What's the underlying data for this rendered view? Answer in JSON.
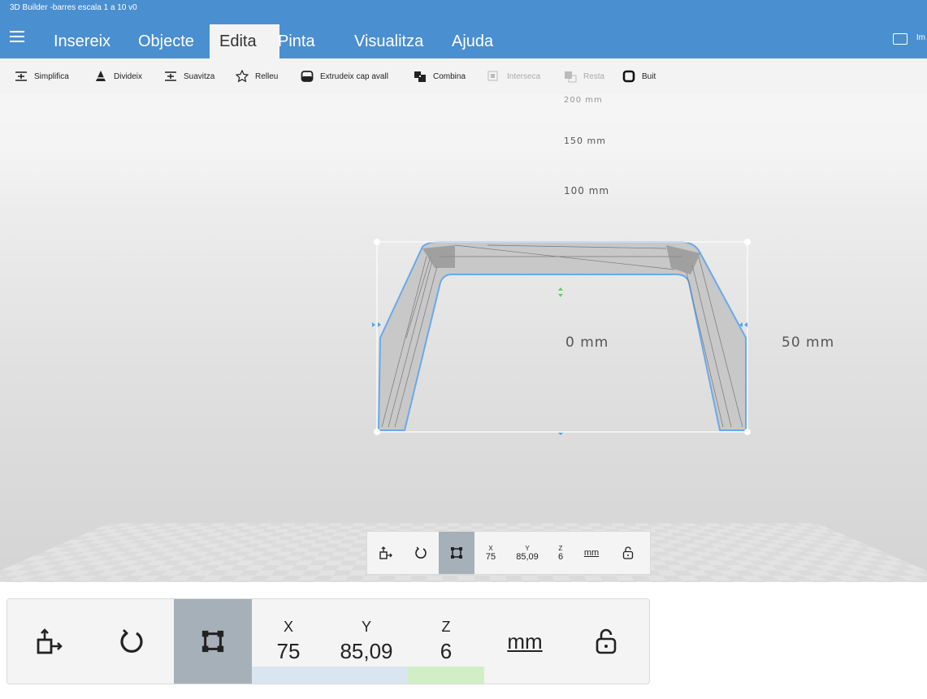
{
  "window": {
    "title": "3D Builder -barres escala 1 a 10 v0"
  },
  "tabs": [
    {
      "label": "Insereix"
    },
    {
      "label": "Objecte"
    },
    {
      "label": "Edita"
    },
    {
      "label": "Pinta"
    },
    {
      "label": "Visualitza"
    },
    {
      "label": "Ajuda"
    }
  ],
  "header_right": {
    "label": "Im"
  },
  "ribbon": {
    "simplify": "Simplifica",
    "split": "Divideix",
    "smooth": "Suavitza",
    "emboss": "Relleu",
    "extrude": "Extrudeix cap avall",
    "combine": "Combina",
    "intersect": "Interseca",
    "subtract": "Resta",
    "hollow": "Buit"
  },
  "viewport": {
    "rulers": [
      "200 mm",
      "150 mm",
      "100 mm",
      "0 mm",
      "50 mm"
    ]
  },
  "transform": {
    "x_label": "X",
    "y_label": "Y",
    "z_label": "Z",
    "x_value": "75",
    "y_value": "85,09",
    "z_value": "6",
    "unit": "mm"
  },
  "colors": {
    "accent": "#4a8fd0",
    "selection": "#6aa9e8",
    "active_tool": "#a6b0b8"
  }
}
